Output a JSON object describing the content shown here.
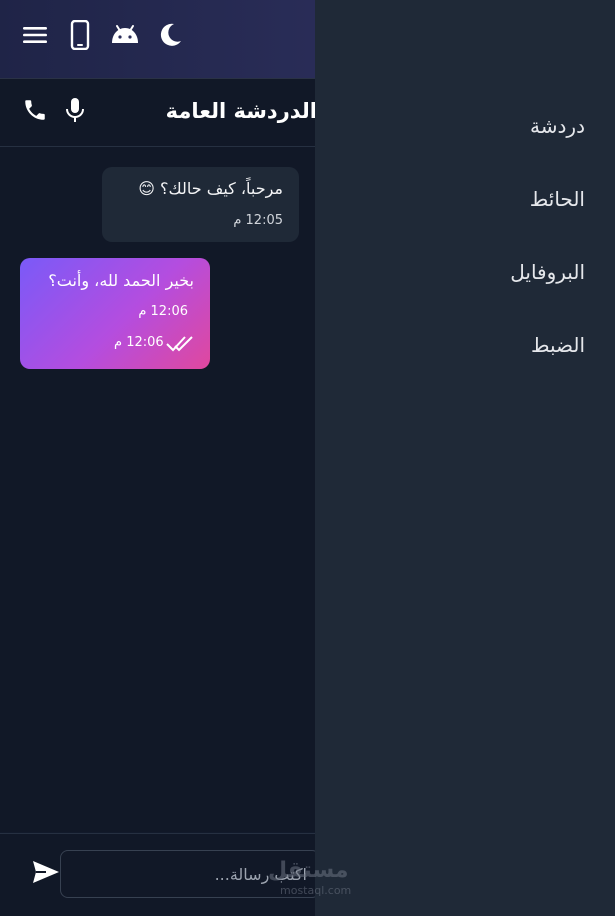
{
  "topbar": {
    "icons": [
      "menu-icon",
      "smartphone-icon",
      "android-icon",
      "moon-icon"
    ]
  },
  "chat": {
    "title": "الدردشة العامة",
    "icons": [
      "phone-icon",
      "microphone-icon"
    ]
  },
  "messages": [
    {
      "direction": "incoming",
      "text": "مرحباً، كيف حالك؟ 😊",
      "time": "12:05 م"
    },
    {
      "direction": "outgoing",
      "text": "بخير الحمد لله، وأنت؟",
      "time": "12:06 م",
      "time_status": "12:06 م",
      "status_icon": "double-check-icon"
    }
  ],
  "composer": {
    "placeholder": "اكتب رسالة...",
    "send_icon": "send-icon"
  },
  "drawer": {
    "items": [
      {
        "label": "دردشة"
      },
      {
        "label": "الحائط"
      },
      {
        "label": "البروفايل"
      },
      {
        "label": "الضبط"
      }
    ]
  },
  "watermark": {
    "arabic": "مستقل",
    "latin": "mostaql.com"
  },
  "colors": {
    "background": "#111827",
    "drawer": "#1f2937",
    "bubble_in": "#1f2937",
    "bubble_out_start": "#7a5af8",
    "bubble_out_end": "#e0489e"
  }
}
